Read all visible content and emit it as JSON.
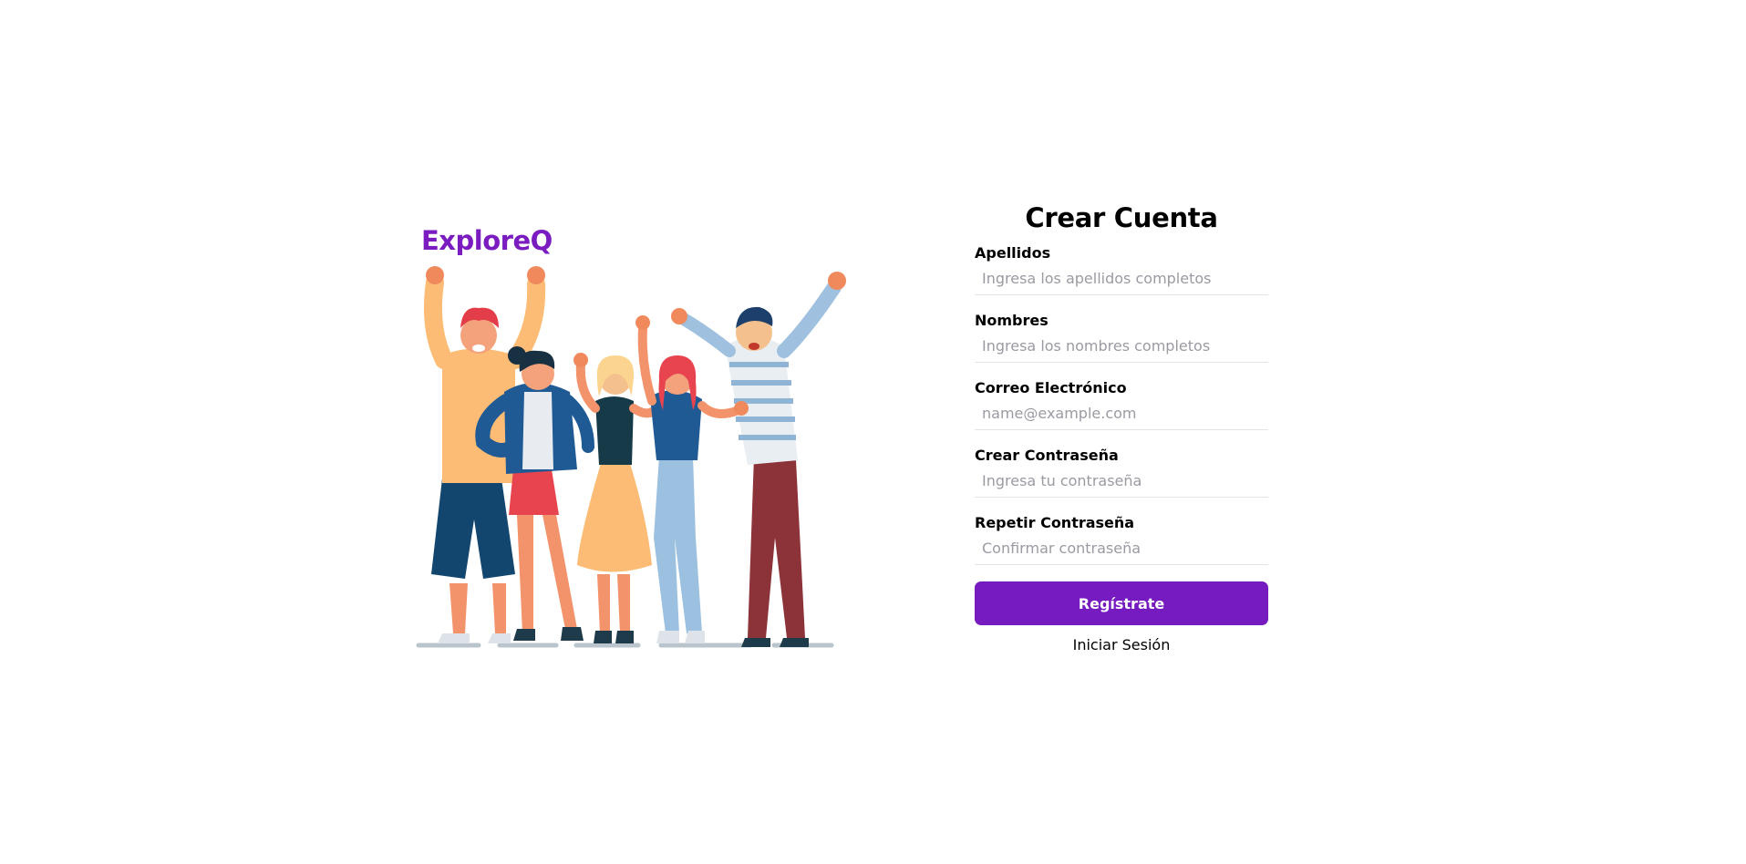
{
  "brand": {
    "name": "ExploreQ"
  },
  "colors": {
    "accent": "#761bbf",
    "brand": "#7a1cbf"
  },
  "illustration": {
    "icon": "group-of-friends-waving-illustration"
  },
  "form": {
    "title": "Crear Cuenta",
    "fields": [
      {
        "label": "Apellidos",
        "placeholder": "Ingresa los apellidos completos",
        "value": ""
      },
      {
        "label": "Nombres",
        "placeholder": "Ingresa los nombres completos",
        "value": ""
      },
      {
        "label": "Correo Electrónico",
        "placeholder": "name@example.com",
        "value": ""
      },
      {
        "label": "Crear Contraseña",
        "placeholder": "Ingresa tu contraseña",
        "value": ""
      },
      {
        "label": "Repetir Contraseña",
        "placeholder": "Confirmar contraseña",
        "value": ""
      }
    ],
    "submit_label": "Regístrate",
    "login_link": "Iniciar Sesión"
  }
}
